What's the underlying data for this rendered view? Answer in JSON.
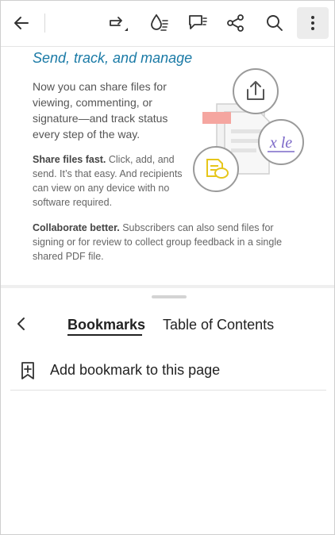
{
  "toolbar": {
    "back_icon": "back-arrow-icon",
    "share_forward_icon": "share-forward-icon",
    "liquid_mode_icon": "liquid-mode-icon",
    "comment_icon": "comment-icon",
    "share_icon": "share-icon",
    "search_icon": "search-icon",
    "more_icon": "more-vertical-icon"
  },
  "page": {
    "heading": "Send, track, and manage",
    "intro": "Now you can share files for viewing, commenting, or signature—and track status every step of the way.",
    "share_bold": "Share files fast.",
    "share_text": " Click, add, and send. It’s that easy. And recipients can view on any device with no software required.",
    "collab_bold": "Collaborate better.",
    "collab_text": " Subscribers can also send files for signing or for review to collect group feedback in a single shared PDF file.",
    "signature_text": "x le"
  },
  "sheet": {
    "tabs": [
      {
        "label": "Bookmarks",
        "active": true
      },
      {
        "label": "Table of Contents",
        "active": false
      }
    ],
    "add_bookmark_label": "Add bookmark to this page"
  },
  "colors": {
    "heading_blue": "#1a7aa6",
    "signature_purple": "#7b68c8",
    "accent_pink": "#f5a6a0",
    "accent_yellow": "#e6c61a"
  }
}
